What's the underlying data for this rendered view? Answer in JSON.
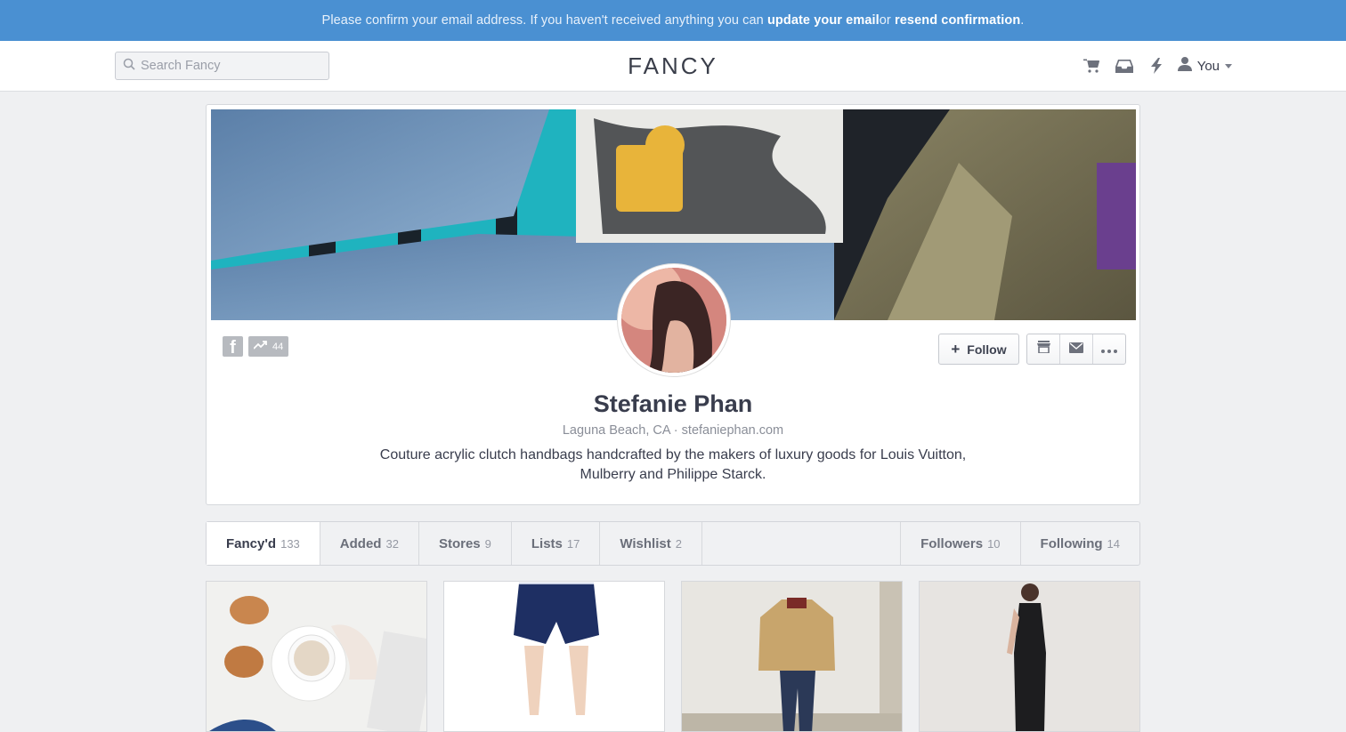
{
  "banner": {
    "text_before": "Please confirm your email address. If you haven't received anything you can ",
    "link_update": "update your email",
    "text_mid": " or ",
    "link_resend": "resend confirmation",
    "text_after": "."
  },
  "header": {
    "search_placeholder": "Search Fancy",
    "logo": "FANCY",
    "icons": [
      "cart-icon",
      "inbox-icon",
      "lightning-icon",
      "user-icon"
    ],
    "user_label": "You"
  },
  "profile": {
    "name": "Stefanie Phan",
    "location": "Laguna Beach, CA",
    "separator": " · ",
    "website": "stefaniephan.com",
    "bio_line1": "Couture acrylic clutch handbags handcrafted by the makers of luxury goods for Louis Vuitton,",
    "bio_line2": "Mulberry and Philippe Starck.",
    "trend_count": "44",
    "follow_label": "Follow",
    "actions": [
      "store-icon",
      "mail-icon",
      "more-icon"
    ]
  },
  "tabs": {
    "left": [
      {
        "label": "Fancy'd",
        "count": "133"
      },
      {
        "label": "Added",
        "count": "32"
      },
      {
        "label": "Stores",
        "count": "9"
      },
      {
        "label": "Lists",
        "count": "17"
      },
      {
        "label": "Wishlist",
        "count": "2"
      }
    ],
    "right": [
      {
        "label": "Followers",
        "count": "10"
      },
      {
        "label": "Following",
        "count": "14"
      }
    ]
  },
  "colors": {
    "banner": "#4a90d2",
    "background": "#eff0f2",
    "text": "#393d4d"
  }
}
